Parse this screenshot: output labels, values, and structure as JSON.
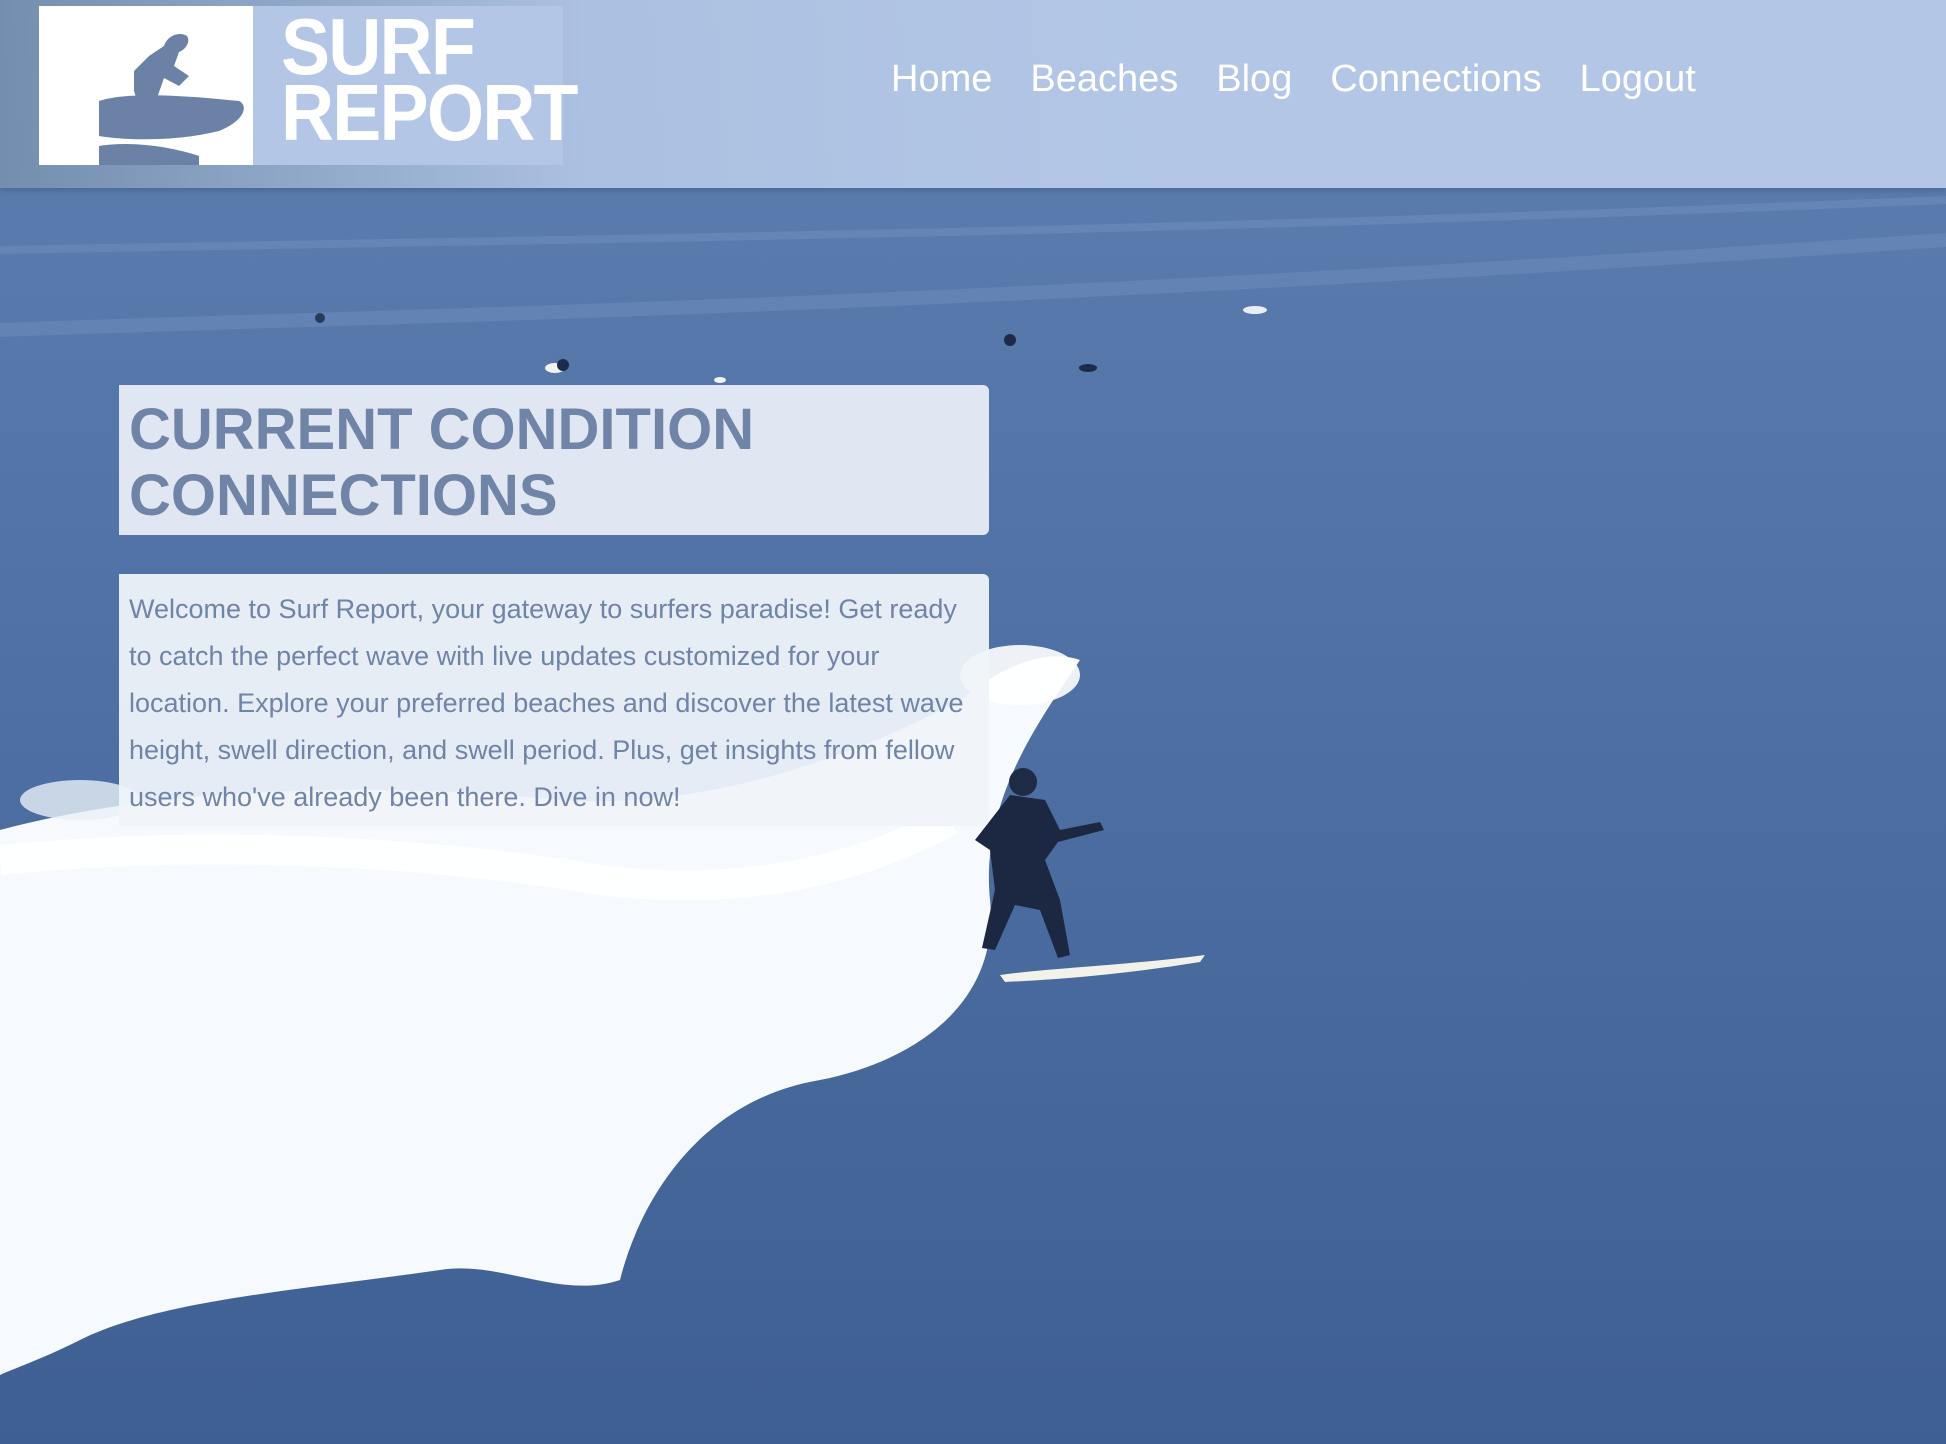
{
  "site": {
    "logo_line1": "SURF",
    "logo_line2": "REPORT"
  },
  "nav": {
    "items": [
      {
        "label": "Home"
      },
      {
        "label": "Beaches"
      },
      {
        "label": "Blog"
      },
      {
        "label": "Connections"
      },
      {
        "label": "Logout"
      }
    ]
  },
  "hero": {
    "title": "CURRENT CONDITION CONNECTIONS",
    "intro": "Welcome to Surf Report, your gateway to surfers paradise! Get ready to catch the perfect wave with live updates customized for your location. Explore your preferred beaches and discover the latest wave height, swell direction, and swell period. Plus, get insights from fellow users who've already been there. Dive in now!"
  },
  "colors": {
    "header_bg": "#b3c6e6",
    "text_accent": "#6f84a6",
    "ocean": "#4a6a9c",
    "white": "#ffffff"
  }
}
